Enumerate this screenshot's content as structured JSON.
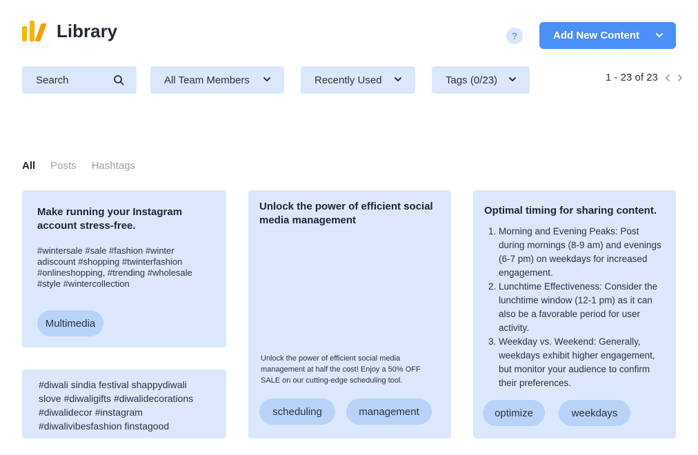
{
  "header": {
    "title": "Library",
    "help_label": "?",
    "add_button_label": "Add New Content"
  },
  "filters": {
    "search_label": "Search",
    "team_label": "All Team Members",
    "sort_label": "Recently Used",
    "tags_label": "Tags (0/23)"
  },
  "pagination": {
    "label": "1 - 23 of 23"
  },
  "tabs": [
    {
      "label": "All",
      "active": true
    },
    {
      "label": "Posts",
      "active": false
    },
    {
      "label": "Hashtags",
      "active": false
    }
  ],
  "cards": [
    {
      "title": "Make running your Instagram account stress-free.",
      "body": "#wintersale #sale #fashion #winter adiscount #shopping #twinterfashion #onlineshopping, #trending #wholesale #style #wintercollection",
      "pills": [
        "Multimedia"
      ]
    },
    {
      "body": "#diwali sindia festival shappydiwali slove #diwaligifts #diwalidecorations #diwalidecor #instagram #diwalivibesfashion finstagood"
    },
    {
      "title": "Unlock the power of efficient social media management",
      "body": "Unlock the power of efficient social media management at half the cost!  Enjoy a 50% OFF SALE on our cutting-edge scheduling tool.",
      "pills": [
        "scheduling",
        "management"
      ]
    },
    {
      "title": "Optimal timing for sharing content.",
      "items": [
        "Morning and Evening Peaks: Post during mornings (8-9 am) and evenings (6-7 pm) on weekdays for increased engagement.",
        "Lunchtime Effectiveness: Consider the lunchtime window (12-1 pm) as it can also be a favorable period for user activity.",
        "Weekday vs. Weekend: Generally, weekdays exhibit higher engagement, but monitor your audience to confirm their preferences."
      ],
      "pills": [
        "optimize",
        "weekdays"
      ]
    }
  ],
  "colors": {
    "accent": "#4a90f7",
    "card_bg": "#dbe8fb",
    "pill_bg": "#b9d2f8",
    "logo": "#f7b500"
  },
  "icons": [
    "logo-icon",
    "search-icon",
    "chevron-down-icon",
    "chevron-left-icon",
    "chevron-right-icon",
    "help-icon"
  ]
}
